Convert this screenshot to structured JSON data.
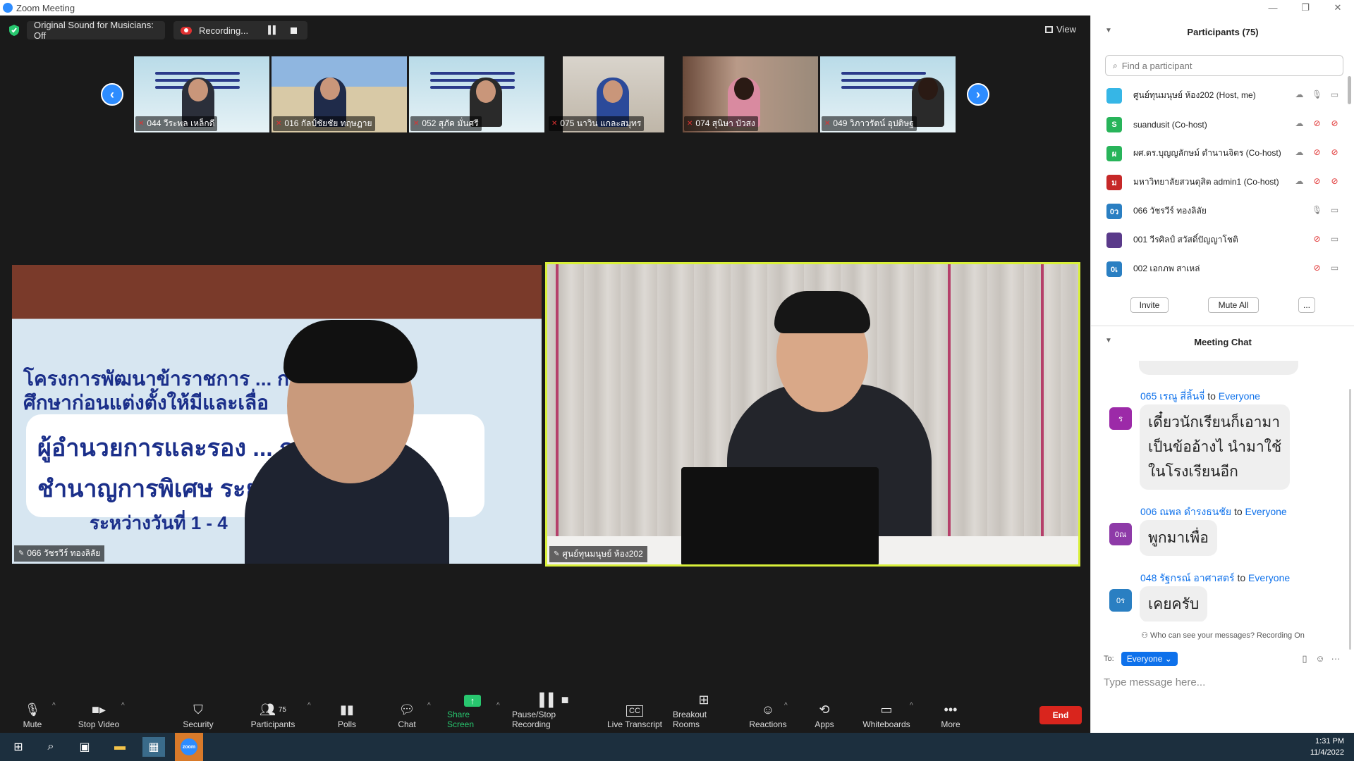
{
  "window": {
    "title": "Zoom Meeting",
    "controls": [
      "—",
      "❐",
      "✕"
    ]
  },
  "top_strip": {
    "sound_label": "Original Sound for Musicians: Off",
    "recording_label": "Recording...",
    "view_label": "View"
  },
  "thumbnails": [
    {
      "name": "044 วีระพล เหล็กดี"
    },
    {
      "name": "016 กัลป์ชัยชัย ทฤษฎาย"
    },
    {
      "name": "052 สุภัค มั่นศรี"
    },
    {
      "name": "075 นาวิน แกละสมุทร"
    },
    {
      "name": "074 สุนิษา บัวสง"
    },
    {
      "name": "049 วิภาวรัตน์ อุปติษฐ"
    }
  ],
  "main_videos": [
    {
      "name": "066 วัชรวีร์ ทองลิลัย",
      "poster_lines": [
        "โครงการพัฒนาข้าราชการ ... การ",
        "ศึกษาก่อนแต่งตั้งให้มีและเลื่อ",
        "ผู้อำนวยการและรอง ... การ",
        "ชำนาญการพิเศษ ระยะ",
        "ระหว่างวันที่ 1 - 4"
      ]
    },
    {
      "name": "ศูนย์ทุนมนุษย์ ห้อง202"
    }
  ],
  "toolbar": {
    "mute": "Mute",
    "stop_video": "Stop Video",
    "security": "Security",
    "participants": "Participants",
    "participants_count": "75",
    "polls": "Polls",
    "chat": "Chat",
    "share_screen": "Share Screen",
    "pause_stop_recording": "Pause/Stop Recording",
    "live_transcript": "Live Transcript",
    "breakout_rooms": "Breakout Rooms",
    "reactions": "Reactions",
    "apps": "Apps",
    "whiteboards": "Whiteboards",
    "more": "More",
    "end": "End"
  },
  "participants_panel": {
    "title": "Participants (75)",
    "search_placeholder": "Find a participant",
    "items": [
      {
        "name": "ศูนย์ทุนมนุษย์ ห้อง202 (Host, me)",
        "initial": "",
        "color": "#36b6e6"
      },
      {
        "name": "suandusit (Co-host)",
        "initial": "S",
        "color": "#28b45a"
      },
      {
        "name": "ผศ.ดร.บุญญลักษม์ ตำนานจิตร (Co-host)",
        "initial": "ผ",
        "color": "#28b45a"
      },
      {
        "name": "มหาวิทยาลัยสวนดุสิต admin1 (Co-host)",
        "initial": "ม",
        "color": "#c62828"
      },
      {
        "name": "066 วัชรวีร์ ทองลิลัย",
        "initial": "0ว",
        "color": "#2a7fc2"
      },
      {
        "name": "001 วีรศิลป์ สวัสดิ์ปัญญาโชติ",
        "initial": "",
        "color": "#5a3a8a"
      },
      {
        "name": "002 เอกภพ สาเหล่",
        "initial": "0เ",
        "color": "#2a7fc2"
      }
    ],
    "invite": "Invite",
    "mute_all": "Mute All",
    "more": "..."
  },
  "chat_panel": {
    "title": "Meeting Chat",
    "messages": [
      {
        "sender": "065 เรณู สี่ลิ้นจี่",
        "to": "Everyone",
        "initial": "ร",
        "color": "#9c2aa8",
        "text": "เดี๋ยวนักเรียนก็เอามา\nเป็นข้ออ้างไ นำมาใช้\nในโรงเรียนอีก"
      },
      {
        "sender": "006 ณพล ดำรงธนชัย",
        "to": "Everyone",
        "initial": "0ณ",
        "color": "#8e3aa8",
        "text": "พูกมาเพื่อ"
      },
      {
        "sender": "048 รัฐกรณ์ อาศาสตร์",
        "to": "Everyone",
        "initial": "0ร",
        "color": "#2a7fc2",
        "text": "เคยครับ"
      }
    ],
    "to_word": "to",
    "who_can_see": "Who can see your messages? Recording On",
    "to_label": "To:",
    "recipient": "Everyone",
    "input_placeholder": "Type message here..."
  },
  "taskbar": {
    "time": "1:31 PM",
    "date": "11/4/2022"
  }
}
